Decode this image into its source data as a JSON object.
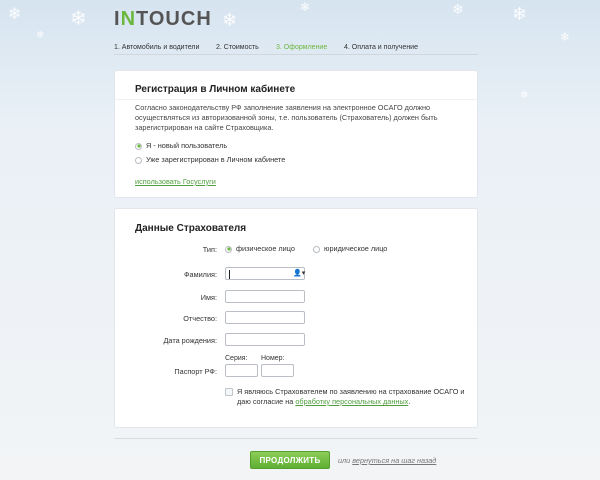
{
  "brand": {
    "logo_prefix": "I",
    "logo_accent": "N",
    "logo_rest": "TOUCH"
  },
  "steps": [
    {
      "label": "1. Автомобиль и водители",
      "active": false
    },
    {
      "label": "2. Стоимость",
      "active": false
    },
    {
      "label": "3. Оформление",
      "active": true
    },
    {
      "label": "4. Оплата и получение",
      "active": false
    }
  ],
  "registration": {
    "title": "Регистрация в Личном кабинете",
    "text": "Согласно законодательству РФ заполнение заявления на электронное ОСАГО должно осуществляться из авторизованной зоны, т.е. пользователь (Страхователь) должен быть зарегистрирован на сайте Страховщика.",
    "options": [
      {
        "label": "Я - новый пользователь",
        "selected": true
      },
      {
        "label": "Уже зарегистрирован в Личном кабинете",
        "selected": false
      }
    ],
    "gosuslugi_link": "использовать Госуслуги"
  },
  "insurer": {
    "title": "Данные Страхователя",
    "type_label": "Тип:",
    "type_options": [
      {
        "label": "физическое лицо",
        "selected": true
      },
      {
        "label": "юридическое лицо",
        "selected": false
      }
    ],
    "fields": {
      "surname_label": "Фамилия:",
      "name_label": "Имя:",
      "patronymic_label": "Отчество:",
      "birthdate_label": "Дата рождения:",
      "passport_label": "Паспорт РФ:",
      "series_label": "Серия:",
      "number_label": "Номер:"
    },
    "person_icon": "person-dropdown-icon",
    "consent_text_1": "Я являюсь Страхователем по заявлению на страхование ОСАГО и",
    "consent_text_2": "даю согласие на",
    "consent_link": "обработку персональных данных",
    "consent_end": "."
  },
  "actions": {
    "continue_label": "ПРОДОЛЖИТЬ",
    "or_label": "или",
    "back_link": "вернуться на шаг назад"
  },
  "colors": {
    "accent": "#6cb83f",
    "button": "#6cb83f"
  }
}
